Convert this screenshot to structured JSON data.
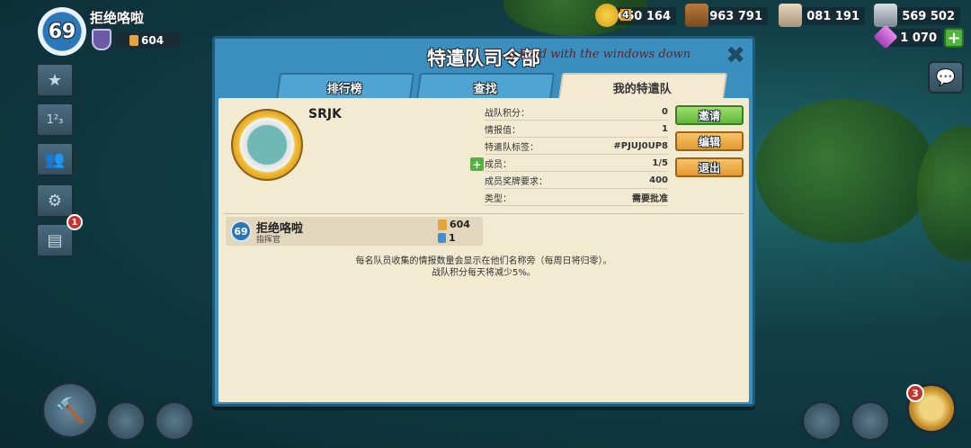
{
  "player": {
    "level": "69",
    "name": "拒绝咯啦",
    "medals": "604"
  },
  "sidebar": {
    "notification_count": "1"
  },
  "resources": {
    "gold_badge": "4",
    "gold": "660 164",
    "wood": "963 791",
    "stone": "1 081 191",
    "iron": "569 502",
    "diamonds": "1 070"
  },
  "panel": {
    "title": "特遣队司令部",
    "overlay_text": "g hard with the windows down",
    "tabs": [
      {
        "label": "排行榜"
      },
      {
        "label": "查找"
      },
      {
        "label": "我的特遣队"
      }
    ],
    "active_tab": 2
  },
  "task_force": {
    "name": "SRJK",
    "info": [
      {
        "label": "战队积分：",
        "value": "0"
      },
      {
        "label": "情报值：",
        "value": "1"
      },
      {
        "label": "特遣队标签：",
        "value": "#PJUJ0UP8"
      },
      {
        "label": "成员：",
        "value": "1/5"
      },
      {
        "label": "成员奖牌要求：",
        "value": "400"
      },
      {
        "label": "类型：",
        "value": "需要批准"
      }
    ],
    "buttons": {
      "invite": "邀请",
      "edit": "编辑",
      "leave": "退出"
    }
  },
  "members": [
    {
      "level": "69",
      "name": "拒绝咯啦",
      "role": "指挥官",
      "medals": "604",
      "intel": "1"
    }
  ],
  "notes": {
    "line1": "每名队员收集的情报数量会显示在他们名称旁（每周日将归零）。",
    "line2": "战队积分每天将减少5%。"
  },
  "bottom": {
    "compass_badge": "3"
  }
}
